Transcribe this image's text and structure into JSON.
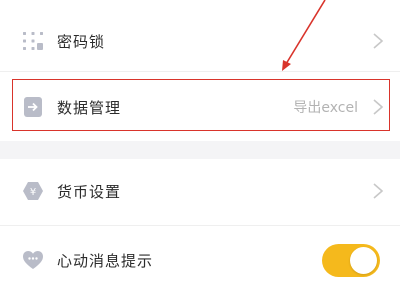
{
  "settings": {
    "items": [
      {
        "label": "密码锁",
        "icon": "dotted-lock-icon"
      },
      {
        "label": "数据管理",
        "value": "导出excel",
        "icon": "data-export-icon"
      },
      {
        "label": "货币设置",
        "icon": "currency-icon"
      },
      {
        "label": "心动消息提示",
        "icon": "heart-message-icon",
        "toggle_on": true
      }
    ]
  },
  "colors": {
    "toggle_on": "#f5b91c",
    "annotation_red": "#d9342b",
    "icon_gray": "#b9bcc8"
  }
}
